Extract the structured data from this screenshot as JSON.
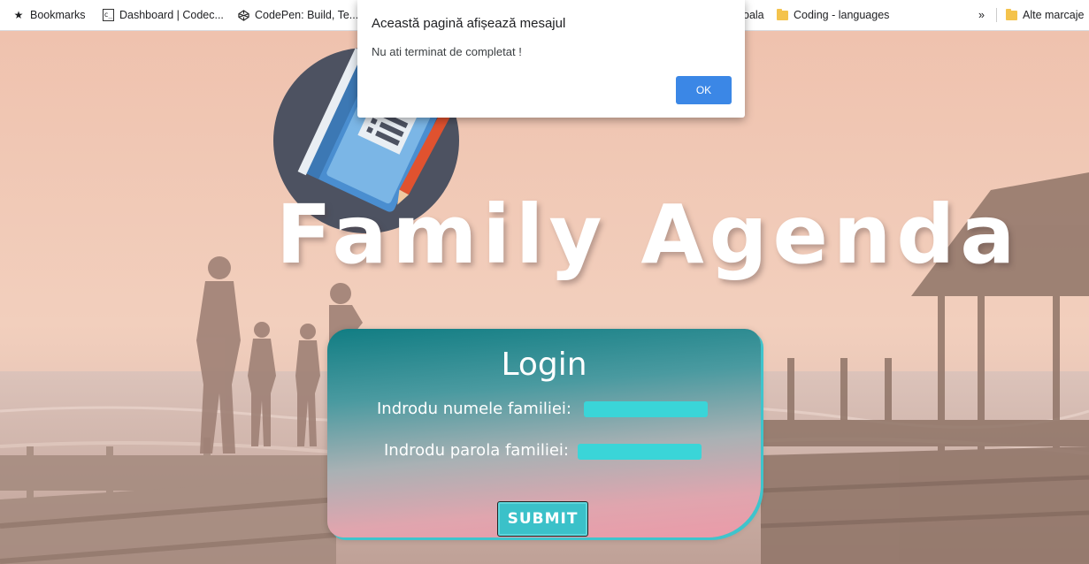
{
  "bookmarks_bar": {
    "items": [
      {
        "label": "Bookmarks",
        "icon": "star-icon"
      },
      {
        "label": "Dashboard | Codec...",
        "icon": "codecademy-icon"
      },
      {
        "label": "CodePen: Build, Te...",
        "icon": "codepen-icon"
      },
      {
        "label": "oala",
        "icon": "folder-icon"
      },
      {
        "label": "Coding - languages",
        "icon": "folder-icon"
      }
    ],
    "overflow_label": "»",
    "other_bookmarks": "Alte marcaje"
  },
  "page": {
    "title": "Family Agenda",
    "login": {
      "title": "Login",
      "family_name_label": "Indrodu numele familiei:",
      "family_password_label": "Indrodu parola familiei:",
      "submit_label": "SUBMIT"
    }
  },
  "alert": {
    "title": "Această pagină afișează mesajul",
    "message": "Nu ati terminat de completat !",
    "ok_label": "OK"
  },
  "colors": {
    "card_top": "#117d83",
    "card_bottom": "#eb9aa8",
    "input_fill": "#3ad5d8",
    "submit_fill": "#3bc1c9",
    "alert_ok": "#3b87e6"
  }
}
